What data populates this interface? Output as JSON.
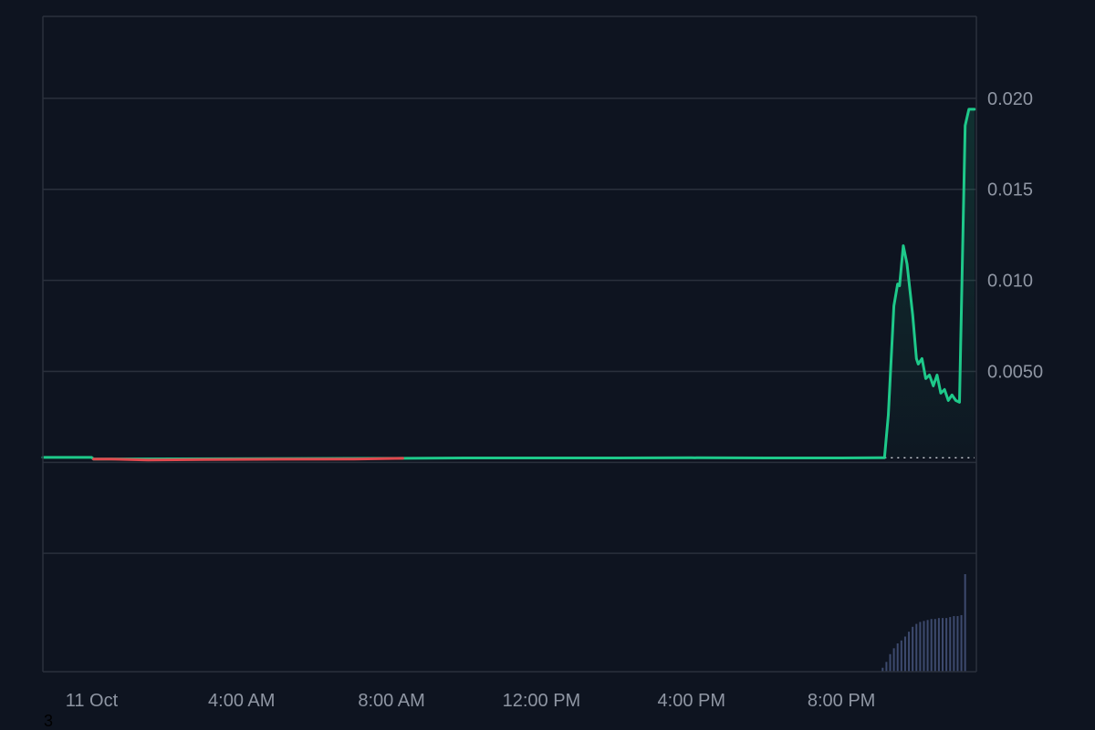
{
  "colors": {
    "background": "#0e1420",
    "grid": "#2a303c",
    "axis_text": "#8f96a3",
    "line_up": "#1ec98a",
    "line_down": "#e0484e",
    "baseline": "#cfd3da",
    "volume": "#3d4a6e"
  },
  "corner_label": "3",
  "chart_data": {
    "type": "line",
    "x_unit": "hours since 11 Oct 00:00",
    "xlim": [
      -1.3,
      23.6
    ],
    "ylim": [
      -0.0115,
      0.0245
    ],
    "grid": true,
    "legend": "none",
    "x_ticks": [
      {
        "label": "11 Oct",
        "value": 0
      },
      {
        "label": "4:00 AM",
        "value": 4
      },
      {
        "label": "8:00 AM",
        "value": 8
      },
      {
        "label": "12:00 PM",
        "value": 12
      },
      {
        "label": "4:00 PM",
        "value": 16
      },
      {
        "label": "8:00 PM",
        "value": 20
      }
    ],
    "y_ticks": [
      {
        "label": "0.020",
        "value": 0.02
      },
      {
        "label": "0.015",
        "value": 0.015
      },
      {
        "label": "0.010",
        "value": 0.01
      },
      {
        "label": "0.0050",
        "value": 0.005
      }
    ],
    "extra_gridlines": [
      0.0,
      -0.005
    ],
    "baseline_value": 0.00025,
    "baseline_start_hour": 21.15,
    "series": [
      {
        "color_role": "down",
        "x": [
          0.05,
          0.5,
          1.5,
          3,
          5,
          7,
          8.3
        ],
        "y": [
          0.00018,
          0.00018,
          0.00013,
          0.00015,
          0.00017,
          0.00018,
          0.00022
        ]
      },
      {
        "color_role": "up",
        "x": [
          -1.3,
          0.0,
          0.05,
          8.3,
          10,
          12,
          14,
          16,
          18,
          20,
          21.0,
          21.15,
          21.25,
          21.4,
          21.5,
          21.55,
          21.65,
          21.75,
          21.9,
          22.0,
          22.05,
          22.15,
          22.25,
          22.35,
          22.45,
          22.55,
          22.65,
          22.75,
          22.85,
          22.95,
          23.05,
          23.15,
          23.3,
          23.4,
          23.45,
          23.5,
          23.55
        ],
        "y": [
          0.00027,
          0.00027,
          0.00018,
          0.00022,
          0.00024,
          0.00024,
          0.00024,
          0.00025,
          0.00024,
          0.00024,
          0.00025,
          0.00025,
          0.0026,
          0.0086,
          0.0098,
          0.0097,
          0.0119,
          0.0109,
          0.0081,
          0.0057,
          0.0054,
          0.0057,
          0.0046,
          0.0048,
          0.0042,
          0.0048,
          0.0038,
          0.004,
          0.0034,
          0.0037,
          0.0034,
          0.0033,
          0.0185,
          0.0194,
          0.0194,
          0.0194,
          0.0194
        ]
      }
    ],
    "volume": {
      "x": [
        21.1,
        21.2,
        21.3,
        21.4,
        21.5,
        21.6,
        21.7,
        21.8,
        21.9,
        22.0,
        22.1,
        22.2,
        22.3,
        22.4,
        22.5,
        22.6,
        22.7,
        22.8,
        22.9,
        23.0,
        23.1,
        23.2,
        23.3
      ],
      "values": [
        4,
        10,
        18,
        24,
        29,
        32,
        36,
        41,
        46,
        49,
        51,
        52,
        53,
        54,
        54,
        55,
        55,
        55,
        56,
        57,
        57,
        58,
        100
      ],
      "max": 100
    }
  }
}
